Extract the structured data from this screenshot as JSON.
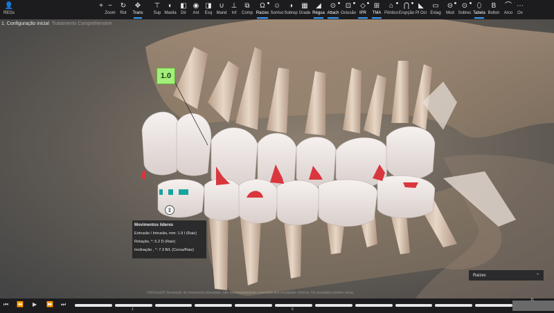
{
  "toolbar": {
    "items": [
      {
        "icon": "user-icon",
        "label": "REGs"
      },
      {
        "icon": "zoom-in-icon",
        "label": ""
      },
      {
        "icon": "zoom-out-icon",
        "label": "Zoom"
      },
      {
        "icon": "rotate-icon",
        "label": "Rot"
      },
      {
        "icon": "move-icon",
        "label": "Trans"
      },
      {
        "icon": "upper-view-icon",
        "label": "Sup"
      },
      {
        "icon": "maxilla-icon",
        "label": "Maxila"
      },
      {
        "icon": "right-view-icon",
        "label": "Dir"
      },
      {
        "icon": "front-view-icon",
        "label": "Ant"
      },
      {
        "icon": "left-view-icon",
        "label": "Esq"
      },
      {
        "icon": "mandible-icon",
        "label": "Mand"
      },
      {
        "icon": "lower-view-icon",
        "label": "Inf"
      },
      {
        "icon": "compare-icon",
        "label": "Comp"
      },
      {
        "icon": "roots-icon",
        "label": "Raizes"
      },
      {
        "icon": "smile-icon",
        "label": "Sorriso"
      },
      {
        "icon": "overlay-icon",
        "label": "Sobrep"
      },
      {
        "icon": "grid-icon",
        "label": "Grade"
      },
      {
        "icon": "ruler-icon",
        "label": "Régua"
      },
      {
        "icon": "attachment-icon",
        "label": "Attach"
      },
      {
        "icon": "occlusion-icon",
        "label": "Oclusão"
      },
      {
        "icon": "ipr-icon",
        "label": "IPR"
      },
      {
        "icon": "tma-icon",
        "label": "TMA"
      },
      {
        "icon": "pontic-icon",
        "label": "Pôntico"
      },
      {
        "icon": "eruption-icon",
        "label": "Erupção"
      },
      {
        "icon": "occlusal-plane-icon",
        "label": "Pl Ocl"
      },
      {
        "icon": "stage-icon",
        "label": "Estag"
      },
      {
        "icon": "mod-icon",
        "label": "Mod"
      },
      {
        "icon": "overcorrection-icon",
        "label": "Sobrec"
      },
      {
        "icon": "table-icon",
        "label": "Tabela"
      },
      {
        "icon": "bolton-icon",
        "label": "Bolton"
      },
      {
        "icon": "arch-icon",
        "label": "Arco"
      },
      {
        "icon": "more-icon",
        "label": "Ov"
      }
    ],
    "glyphs": [
      "👤",
      "+",
      "−",
      "↻",
      "✥",
      "⊤",
      "◐",
      "◧",
      "◉",
      "◨",
      "∪",
      "⊥",
      "⧉",
      "Ω",
      "☺",
      "◑",
      "▦",
      "◢",
      "⊙",
      "⊡",
      "◇",
      "⊞",
      "⌂",
      "⋂",
      "◣",
      "▭",
      "⊝",
      "⊙",
      "⬯",
      "B",
      "⌒",
      "⋯"
    ]
  },
  "breadcrumb": {
    "step": "1. Configuração inicial",
    "plan": "Tratamento Comprehensive"
  },
  "tooth_label": "1.0",
  "moves": {
    "title": "Movimentos líderes",
    "rows": [
      "Extrusão / Intrusão, mm: 1.9 I (Raiz)",
      "Rotação, °: 5.2 D (Raiz)",
      "Inclinação , °: 7.3 B/L (Coroa/Raiz)"
    ]
  },
  "roots_panel": {
    "label": "Raízes",
    "chevron": "⌃"
  },
  "watermark": "ClinCheck® Simulação do movimento planejado, não necessariamente a precisão dos resultados clínicos. Os resultados podem variar.",
  "timeline": {
    "controls": [
      "⏮",
      "⏪",
      "▶",
      "⏩",
      "⏭"
    ],
    "start_number": "1",
    "mid_number": "5",
    "end_number": "11"
  },
  "colors": {
    "toolbar_bg": "#1c1c1e",
    "label_green": "#a4ee7c",
    "accent_blue": "#3aa0ff",
    "ipr_red": "#d9363e",
    "attachment_teal": "#19a3a0"
  }
}
